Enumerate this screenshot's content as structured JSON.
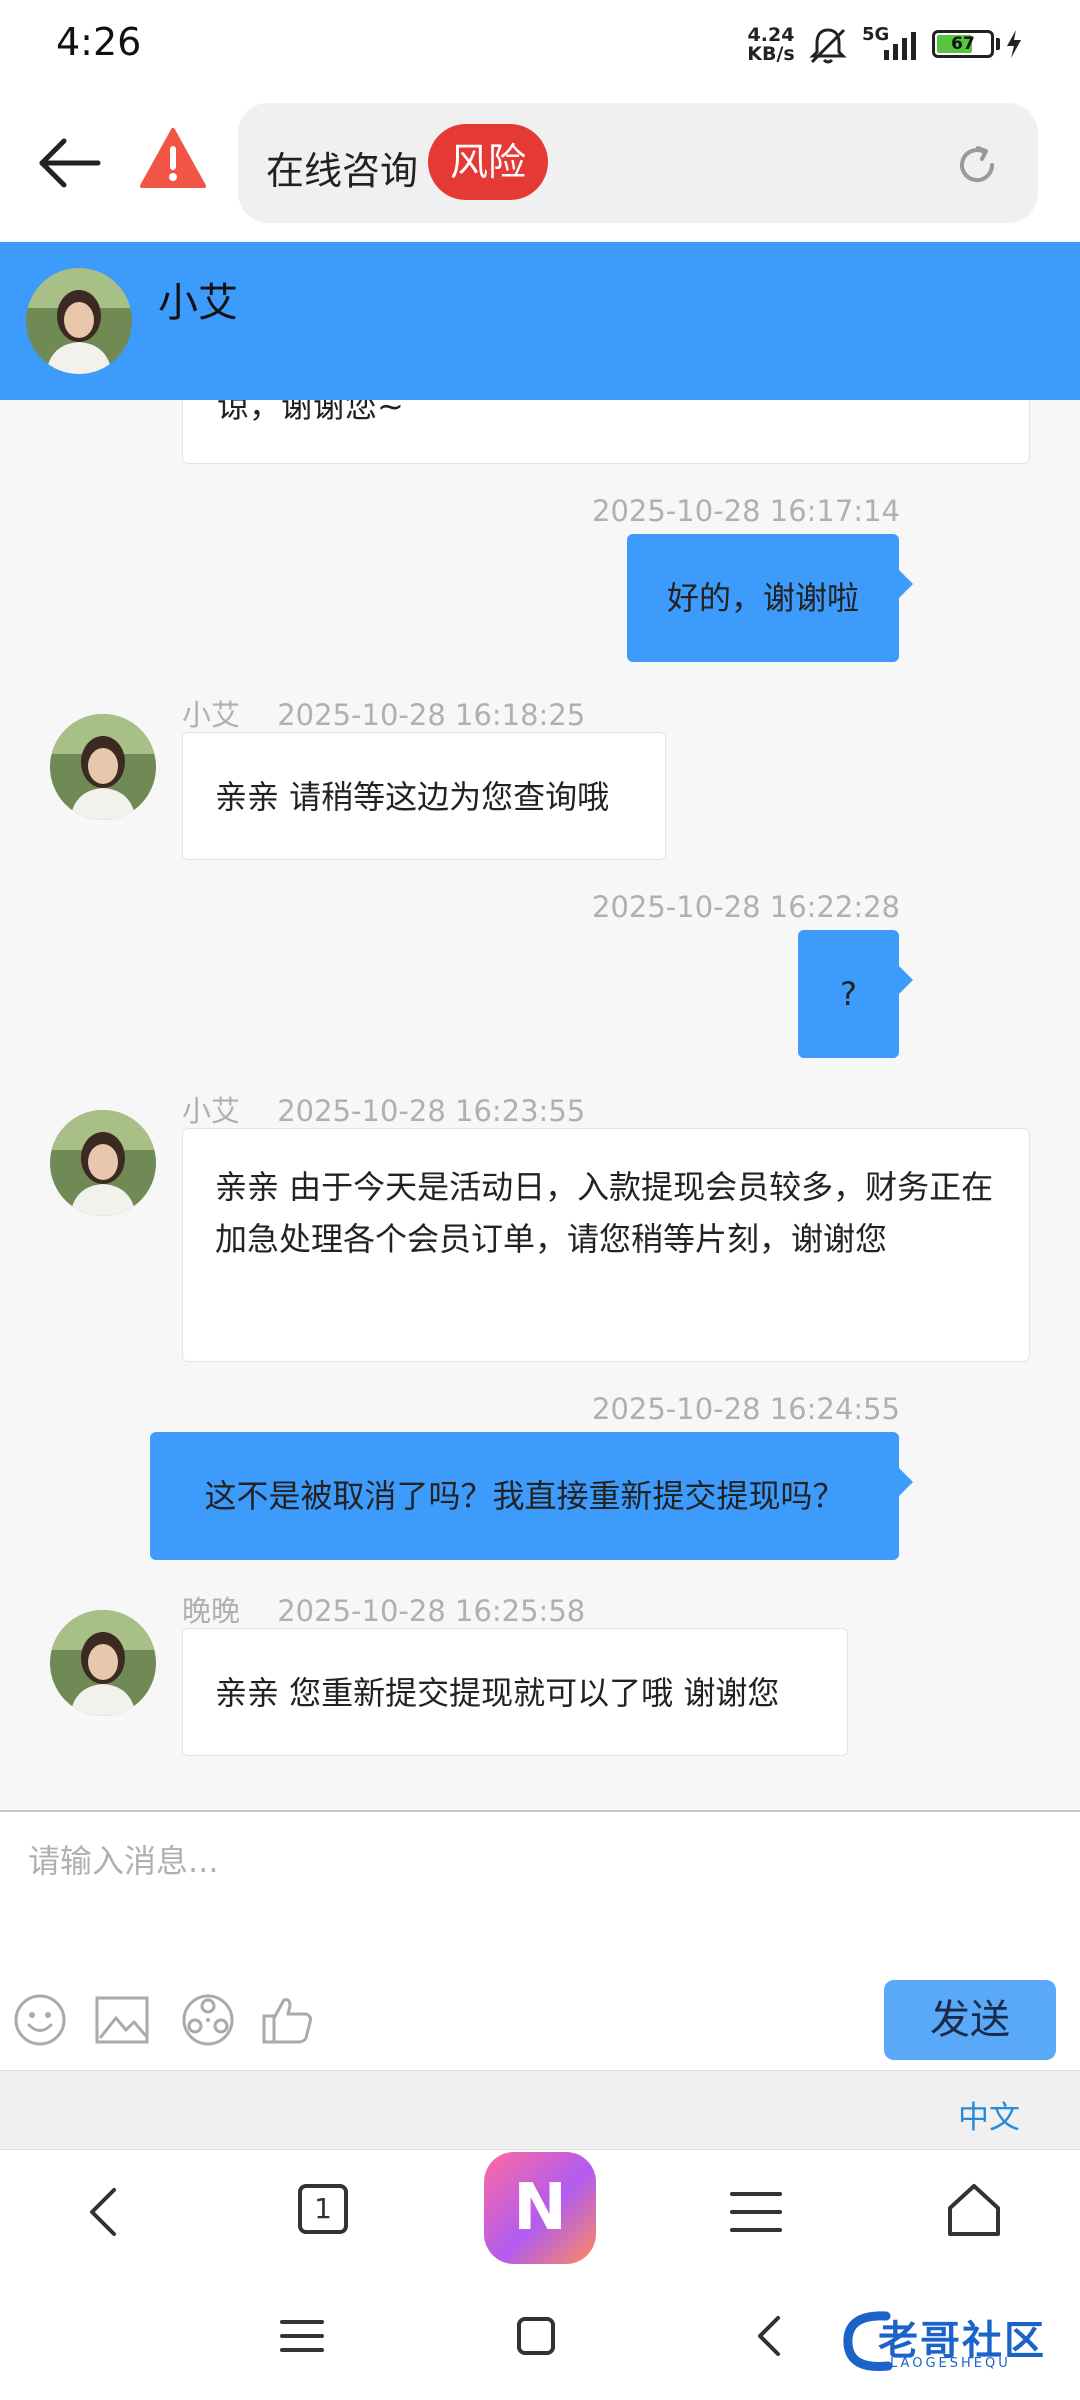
{
  "status_bar": {
    "time": "4:26",
    "net_speed_value": "4.24",
    "net_speed_unit": "KB/s",
    "network": "5G",
    "battery": "67",
    "battery_level": 0.67
  },
  "browser_bar": {
    "title": "在线咨询",
    "risk_label": "风险"
  },
  "chat": {
    "agent_name": "小艾",
    "partial_message": "谅，谢谢您~",
    "messages": [
      {
        "direction": "out",
        "timestamp": "2025-10-28 16:17:14",
        "text": "好的，谢谢啦"
      },
      {
        "direction": "in",
        "sender": "小艾",
        "timestamp": "2025-10-28 16:18:25",
        "text": "亲亲 请稍等这边为您查询哦"
      },
      {
        "direction": "out",
        "timestamp": "2025-10-28 16:22:28",
        "text": "?"
      },
      {
        "direction": "in",
        "sender": "小艾",
        "timestamp": "2025-10-28 16:23:55",
        "text": "亲亲 由于今天是活动日，入款提现会员较多，财务正在加急处理各个会员订单，请您稍等片刻，谢谢您"
      },
      {
        "direction": "out",
        "timestamp": "2025-10-28 16:24:55",
        "text": "这不是被取消了吗？我直接重新提交提现吗？"
      },
      {
        "direction": "in",
        "sender": "晚晚",
        "timestamp": "2025-10-28 16:25:58",
        "text": "亲亲 您重新提交提现就可以了哦 谢谢您"
      }
    ]
  },
  "input": {
    "placeholder": "请输入消息...",
    "send_label": "发送",
    "tools": [
      "emoji-icon",
      "image-icon",
      "film-reel-icon",
      "thumbs-up-icon"
    ]
  },
  "language": {
    "label": "中文"
  },
  "browser_nav": {
    "tab_count": "1",
    "logo_letter": "N"
  },
  "watermark": {
    "text": "老哥社区",
    "sub": "LAOGESHEQU"
  },
  "colors": {
    "accent": "#3d9bfb",
    "risk": "#e53935",
    "warning": "#f05545",
    "send_button": "#5aa8f8",
    "link": "#2a8ad6"
  }
}
